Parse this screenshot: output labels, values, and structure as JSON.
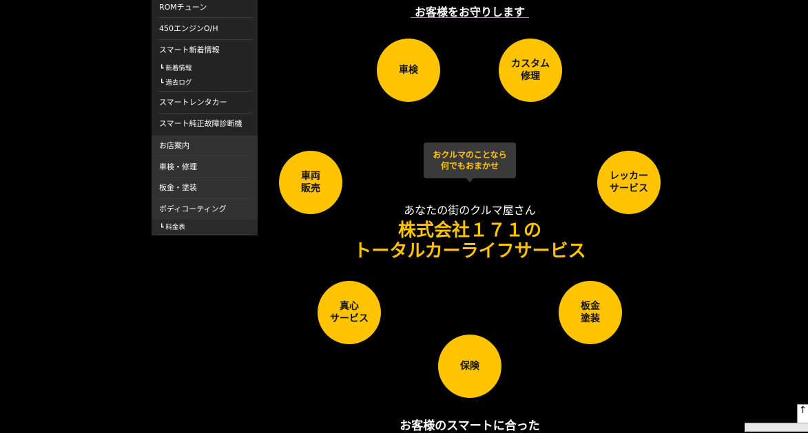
{
  "sidebar": {
    "items": [
      {
        "label": "ROMチューン"
      },
      {
        "label": "450エンジンO/H"
      },
      {
        "label": "スマート新着情報"
      },
      {
        "label": "新着情報"
      },
      {
        "label": "過去ログ"
      },
      {
        "label": "スマートレンタカー"
      },
      {
        "label": "スマート純正故障診断機"
      },
      {
        "label": "お店案内"
      },
      {
        "label": "車検・修理"
      },
      {
        "label": "板金・塗装"
      },
      {
        "label": "ボディコーティング"
      },
      {
        "label": "料金表"
      }
    ],
    "sub_arrow": "┗"
  },
  "main": {
    "top_heading": "お客様をお守りします",
    "tooltip": {
      "line1": "おクルマのことなら",
      "line2": "何でもおまかせ"
    },
    "tagline": "あなたの街のクルマ屋さん",
    "company": "株式会社１７１の",
    "service": "トータルカーライフサービス",
    "circles": [
      {
        "line1": "車検",
        "line2": ""
      },
      {
        "line1": "カスタム",
        "line2": "修理"
      },
      {
        "line1": "車両",
        "line2": "販売"
      },
      {
        "line1": "レッカー",
        "line2": "サービス"
      },
      {
        "line1": "真心",
        "line2": "サービス"
      },
      {
        "line1": "板金",
        "line2": "塗装"
      },
      {
        "line1": "保険",
        "line2": ""
      }
    ],
    "bottom_heading": "お客様のスマートに合った"
  },
  "widget": {
    "scroll_top_icon": "↑"
  },
  "colors": {
    "accent": "#ffc400",
    "sidebar_bg": "#242424",
    "sidebar_band": "#323232",
    "background": "#000000"
  }
}
